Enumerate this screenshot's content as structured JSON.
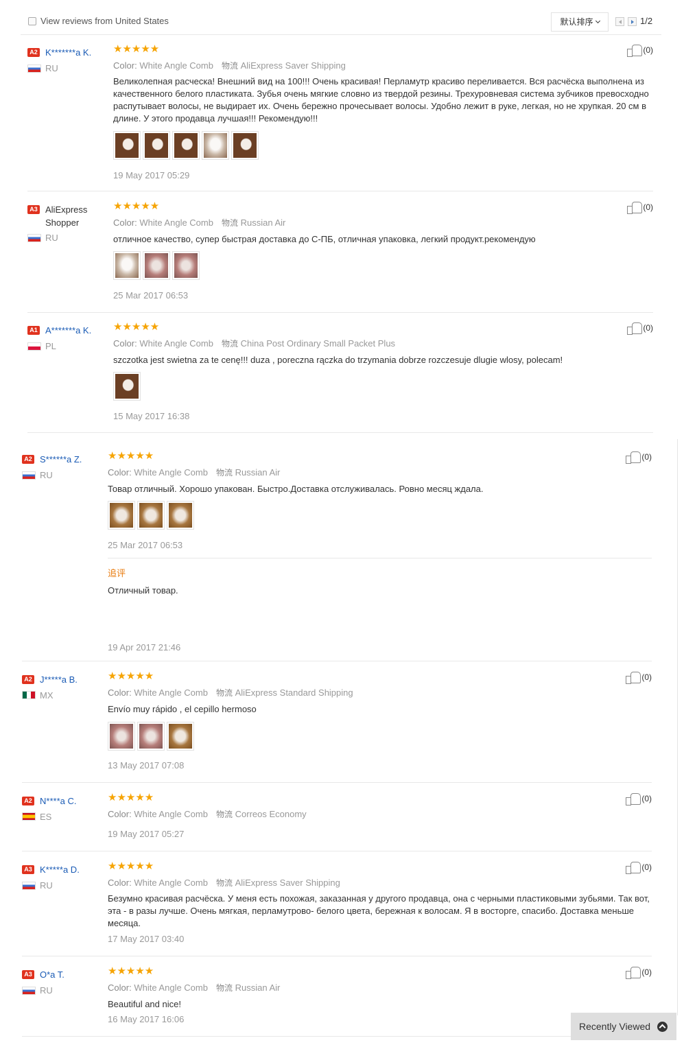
{
  "filter": {
    "label": "View reviews from United States"
  },
  "sort": {
    "label": "默认排序"
  },
  "pagination": {
    "page": "1/2"
  },
  "labels": {
    "color": "Color:",
    "shipping": "物流",
    "additional": "追评"
  },
  "reviews": [
    {
      "level": "A2",
      "name": "K*******a K.",
      "country": "RU",
      "rating": 5,
      "stars": "★★★★★",
      "color": "White Angle Comb",
      "shipping": "AliExpress Saver Shipping",
      "text": "Великолепная расческа! Внешний вид на 100!!! Очень красивая! Перламутр красиво переливается. Вся расчёска выполнена из качественного белого пластиката. Зубья очень мягкие словно из твердой резины. Трехуровневая система зубчиков превосходно распутывает волосы, не выдирает их. Очень бережно прочесывает волосы. Удобно лежит в руке, легкая, но не хрупкая. 20 см в длине. У этого продавца лучшая!!! Рекомендую!!!",
      "date": "19 May 2017 05:29",
      "likes": "(0)"
    },
    {
      "level": "A3",
      "name": "AliExpress Shopper",
      "country": "RU",
      "rating": 5,
      "stars": "★★★★★",
      "color": "White Angle Comb",
      "shipping": "Russian Air",
      "text": "отличное качество, супер быстрая доставка до С-ПБ, отличная упаковка, легкий продукт.рекомендую",
      "date": "25 Mar 2017 06:53",
      "likes": "(0)"
    },
    {
      "level": "A1",
      "name": "A*******a K.",
      "country": "PL",
      "rating": 5,
      "stars": "★★★★★",
      "color": "White Angle Comb",
      "shipping": "China Post Ordinary Small Packet Plus",
      "text": "szczotka jest swietna za te cenę!!! duza , poreczna rączka do trzymania dobrze rozczesuje dlugie wlosy, polecam!",
      "date": "15 May 2017 16:38",
      "likes": "(0)"
    },
    {
      "level": "A2",
      "name": "S******a Z.",
      "country": "RU",
      "rating": 5,
      "stars": "★★★★★",
      "color": "White Angle Comb",
      "shipping": "Russian Air",
      "text": "Товар отличный. Хорошо упакован. Быстро.Доставка отслуживалась. Ровно месяц ждала.",
      "date": "25 Mar 2017 06:53",
      "additional_text": "Отличный товар.",
      "additional_date": "19 Apr 2017 21:46",
      "likes": "(0)"
    },
    {
      "level": "A2",
      "name": "J*****a B.",
      "country": "MX",
      "rating": 5,
      "stars": "★★★★★",
      "color": "White Angle Comb",
      "shipping": "AliExpress Standard Shipping",
      "text": "Envío muy rápido , el cepillo hermoso",
      "date": "13 May 2017 07:08",
      "likes": "(0)"
    },
    {
      "level": "A2",
      "name": "N****a C.",
      "country": "ES",
      "rating": 5,
      "stars": "★★★★★",
      "color": "White Angle Comb",
      "shipping": "Correos Economy",
      "date": "19 May 2017 05:27",
      "likes": "(0)"
    },
    {
      "level": "A3",
      "name": "K*****a D.",
      "country": "RU",
      "rating": 5,
      "stars": "★★★★★",
      "color": "White Angle Comb",
      "shipping": "AliExpress Saver Shipping",
      "text": "Безумно красивая расчёска. У меня есть похожая, заказанная у другого продавца, она с черными пластиковыми зубьями. Так вот, эта - в разы лучше. Очень мягкая, перламутрово- белого цвета, бережная к волосам. Я в восторге, спасибо. Доставка меньше месяца.",
      "date": "17 May 2017 03:40",
      "likes": "(0)"
    },
    {
      "level": "A3",
      "name": "O*a T.",
      "country": "RU",
      "rating": 5,
      "stars": "★★★★★",
      "color": "White Angle Comb",
      "shipping": "Russian Air",
      "text": "Beautiful and nice!",
      "date": "16 May 2017 16:06",
      "likes": "(0)"
    }
  ],
  "recently_viewed": {
    "label": "Recently Viewed"
  },
  "colors": {
    "link": "#1a5bb5",
    "star": "#f6a405",
    "badge": "#e0321e",
    "accent": "#e87b0e"
  }
}
